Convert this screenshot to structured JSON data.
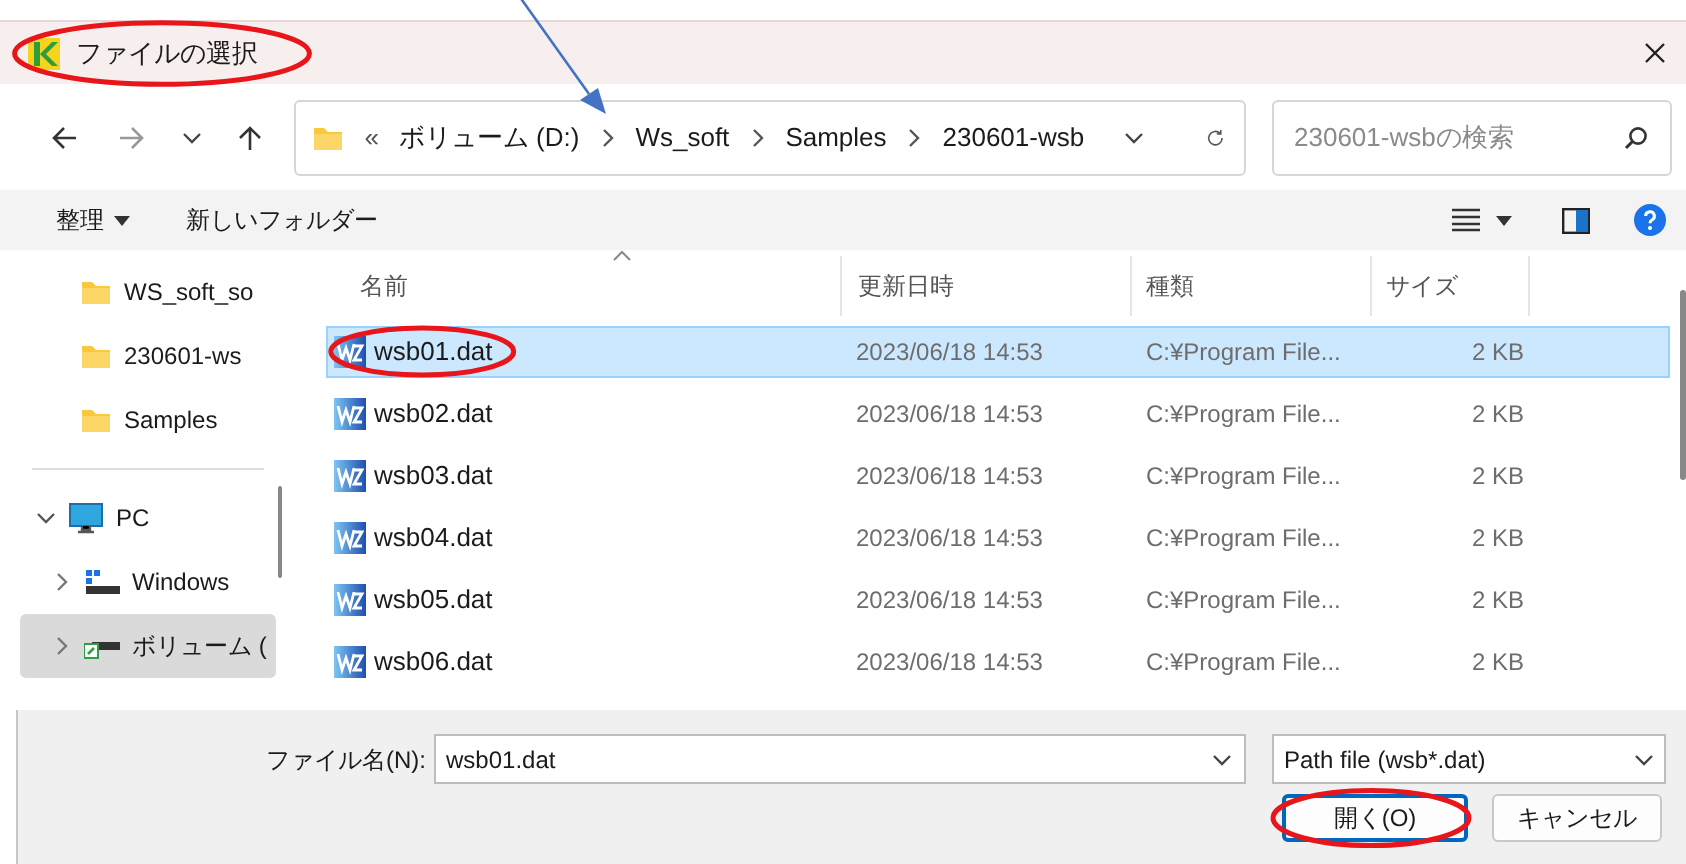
{
  "window": {
    "title": "ファイルの選択",
    "circled": true
  },
  "address_bar": {
    "overflow": "«",
    "segments": [
      {
        "label": "ボリューム (D:)"
      },
      {
        "label": "Ws_soft",
        "pointed": true
      },
      {
        "label": "Samples"
      },
      {
        "label": "230601-wsb"
      }
    ]
  },
  "search": {
    "placeholder": "230601-wsbの検索"
  },
  "toolbar": {
    "organize": "整理",
    "new_folder": "新しいフォルダー"
  },
  "nav_pane": {
    "items": [
      {
        "label": "WS_soft_so",
        "kind": "folder",
        "selected": false
      },
      {
        "label": "230601-ws",
        "kind": "folder",
        "selected": false
      },
      {
        "label": "Samples",
        "kind": "folder",
        "selected": false
      },
      {
        "label": "PC",
        "kind": "pc",
        "selected": false,
        "expanded": true,
        "children": [
          {
            "label": "Windows",
            "kind": "system",
            "selected": false,
            "expanded": false
          },
          {
            "label": "ボリューム (",
            "kind": "drive",
            "selected": true,
            "expanded": false
          }
        ]
      }
    ]
  },
  "file_list": {
    "columns": [
      "名前",
      "更新日時",
      "種類",
      "サイズ"
    ],
    "rows": [
      {
        "name": "wsb01.dat",
        "modified": "2023/06/18 14:53",
        "type": "C:¥Program File...",
        "size": "2 KB",
        "selected": true,
        "circled": true
      },
      {
        "name": "wsb02.dat",
        "modified": "2023/06/18 14:53",
        "type": "C:¥Program File...",
        "size": "2 KB",
        "selected": false,
        "circled": false
      },
      {
        "name": "wsb03.dat",
        "modified": "2023/06/18 14:53",
        "type": "C:¥Program File...",
        "size": "2 KB",
        "selected": false,
        "circled": false
      },
      {
        "name": "wsb04.dat",
        "modified": "2023/06/18 14:53",
        "type": "C:¥Program File...",
        "size": "2 KB",
        "selected": false,
        "circled": false
      },
      {
        "name": "wsb05.dat",
        "modified": "2023/06/18 14:53",
        "type": "C:¥Program File...",
        "size": "2 KB",
        "selected": false,
        "circled": false
      },
      {
        "name": "wsb06.dat",
        "modified": "2023/06/18 14:53",
        "type": "C:¥Program File...",
        "size": "2 KB",
        "selected": false,
        "circled": false
      }
    ]
  },
  "file_name": {
    "label": "ファイル名(N):",
    "value": "wsb01.dat"
  },
  "file_type": {
    "value": "Path file (wsb*.dat)"
  },
  "buttons": [
    {
      "label": "開く(O)",
      "kind": "primary",
      "circled": true
    },
    {
      "label": "キャンセル",
      "kind": "secondary",
      "circled": false
    }
  ]
}
